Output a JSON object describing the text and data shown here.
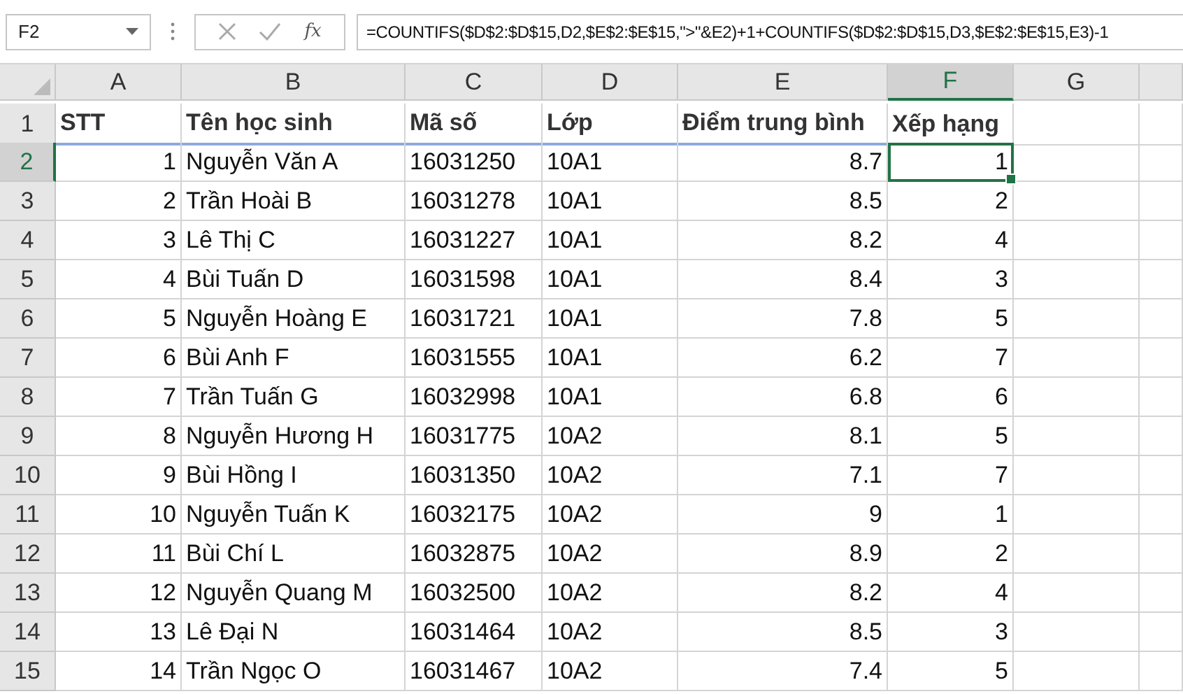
{
  "name_box": "F2",
  "function_button": "fx",
  "formula": "=COUNTIFS($D$2:$D$15,D2,$E$2:$E$15,\">\"&E2)+1+COUNTIFS($D$2:$D$15,D3,$E$2:$E$15,E3)-1",
  "columns": [
    {
      "letter": "A",
      "selected": false,
      "kind": "number"
    },
    {
      "letter": "B",
      "selected": false,
      "kind": "text"
    },
    {
      "letter": "C",
      "selected": false,
      "kind": "text"
    },
    {
      "letter": "D",
      "selected": false,
      "kind": "text"
    },
    {
      "letter": "E",
      "selected": false,
      "kind": "number"
    },
    {
      "letter": "F",
      "selected": true,
      "kind": "number"
    },
    {
      "letter": "G",
      "selected": false,
      "kind": "text"
    }
  ],
  "rows": [
    {
      "number": "1",
      "selected": false,
      "kind": "header",
      "cells": [
        "STT",
        "Tên học sinh",
        "Mã số",
        "Lớp",
        "Điểm trung bình",
        "Xếp hạng"
      ]
    },
    {
      "number": "2",
      "selected": true,
      "kind": "data",
      "cells": [
        "1",
        "Nguyễn Văn A",
        "16031250",
        "10A1",
        "8.7",
        "1"
      ]
    },
    {
      "number": "3",
      "selected": false,
      "kind": "data",
      "cells": [
        "2",
        "Trần Hoài B",
        "16031278",
        "10A1",
        "8.5",
        "2"
      ]
    },
    {
      "number": "4",
      "selected": false,
      "kind": "data",
      "cells": [
        "3",
        "Lê Thị C",
        "16031227",
        "10A1",
        "8.2",
        "4"
      ]
    },
    {
      "number": "5",
      "selected": false,
      "kind": "data",
      "cells": [
        "4",
        "Bùi Tuấn D",
        "16031598",
        "10A1",
        "8.4",
        "3"
      ]
    },
    {
      "number": "6",
      "selected": false,
      "kind": "data",
      "cells": [
        "5",
        "Nguyễn Hoàng E",
        "16031721",
        "10A1",
        "7.8",
        "5"
      ]
    },
    {
      "number": "7",
      "selected": false,
      "kind": "data",
      "cells": [
        "6",
        "Bùi Anh F",
        "16031555",
        "10A1",
        "6.2",
        "7"
      ]
    },
    {
      "number": "8",
      "selected": false,
      "kind": "data",
      "cells": [
        "7",
        "Trần Tuấn G",
        "16032998",
        "10A1",
        "6.8",
        "6"
      ]
    },
    {
      "number": "9",
      "selected": false,
      "kind": "data",
      "cells": [
        "8",
        "Nguyễn Hương H",
        "16031775",
        "10A2",
        "8.1",
        "5"
      ]
    },
    {
      "number": "10",
      "selected": false,
      "kind": "data",
      "cells": [
        "9",
        "Bùi Hồng I",
        "16031350",
        "10A2",
        "7.1",
        "7"
      ]
    },
    {
      "number": "11",
      "selected": false,
      "kind": "data",
      "cells": [
        "10",
        "Nguyễn Tuấn K",
        "16032175",
        "10A2",
        "9",
        "1"
      ]
    },
    {
      "number": "12",
      "selected": false,
      "kind": "data",
      "cells": [
        "11",
        "Bùi Chí L",
        "16032875",
        "10A2",
        "8.9",
        "2"
      ]
    },
    {
      "number": "13",
      "selected": false,
      "kind": "data",
      "cells": [
        "12",
        "Nguyễn Quang M",
        "16032500",
        "10A2",
        "8.2",
        "4"
      ]
    },
    {
      "number": "14",
      "selected": false,
      "kind": "data",
      "cells": [
        "13",
        "Lê Đại N",
        "16031464",
        "10A2",
        "8.5",
        "3"
      ]
    },
    {
      "number": "15",
      "selected": false,
      "kind": "data",
      "cells": [
        "14",
        "Trần Ngọc O",
        "16031467",
        "10A2",
        "7.4",
        "5"
      ]
    }
  ]
}
